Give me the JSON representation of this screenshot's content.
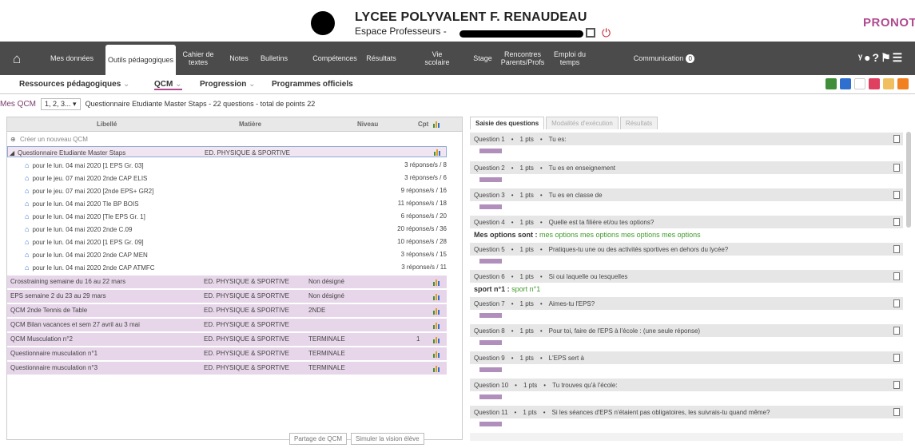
{
  "header": {
    "school": "LYCEE POLYVALENT F. RENAUDEAU",
    "space": "Espace Professeurs -",
    "logo": "PRONOTE",
    "power_icon": "power-icon",
    "qr_icon": "qr-code-icon"
  },
  "nav": {
    "items": [
      {
        "label": "Mes données"
      },
      {
        "label": "Outils pédagogiques"
      },
      {
        "label": "Cahier de textes"
      },
      {
        "label": "Notes"
      },
      {
        "label": "Bulletins"
      },
      {
        "label": "Compétences"
      },
      {
        "label": "Résultats"
      },
      {
        "label": "Vie scolaire"
      },
      {
        "label": "Stage"
      },
      {
        "label": "Rencontres Parents/Profs"
      },
      {
        "label": "Emploi du temps"
      },
      {
        "label": "Communication"
      }
    ],
    "communication_badge": "0",
    "home_icon": "home-icon"
  },
  "subnav": {
    "ressources": "Ressources pédagogiques",
    "qcm": "QCM",
    "progression": "Progression",
    "programmes": "Programmes officiels"
  },
  "mesqcm": {
    "label": "Mes QCM",
    "select": "1, 2, 3...",
    "description": "Questionnaire Etudiante Master Staps - 22 questions - total de points 22"
  },
  "table": {
    "headers": {
      "libelle": "Libellé",
      "matiere": "Matière",
      "niveau": "Niveau",
      "cpt": "Cpt"
    },
    "create": "Créer un nouveau QCM",
    "selected": {
      "label": "Questionnaire Etudiante Master Staps",
      "matiere": "ED. PHYSIQUE & SPORTIVE"
    },
    "sessions": [
      {
        "label": "pour le lun. 04 mai 2020  [1 EPS Gr. 03]",
        "resp": "3 réponse/s / 8"
      },
      {
        "label": "pour le jeu. 07 mai 2020  2nde CAP ELIS",
        "resp": "3 réponse/s / 6"
      },
      {
        "label": "pour le jeu. 07 mai 2020  [2nde EPS+ GR2]",
        "resp": "9 réponse/s / 16"
      },
      {
        "label": "pour le lun. 04 mai 2020  Tle BP BOIS",
        "resp": "11 réponse/s / 18"
      },
      {
        "label": "pour le lun. 04 mai 2020  [Tle EPS Gr. 1]",
        "resp": "6 réponse/s / 20"
      },
      {
        "label": "pour le lun. 04 mai 2020  2nde C.09",
        "resp": "20 réponse/s / 36"
      },
      {
        "label": "pour le lun. 04 mai 2020  [1 EPS Gr. 09]",
        "resp": "10 réponse/s / 28"
      },
      {
        "label": "pour le lun. 04 mai 2020  2nde CAP MEN",
        "resp": "3 réponse/s / 15"
      },
      {
        "label": "pour le lun. 04 mai 2020  2nde CAP ATMFC",
        "resp": "3 réponse/s / 11"
      }
    ],
    "qcms": [
      {
        "label": "Crosstraining semaine du 16 au 22 mars",
        "matiere": "ED. PHYSIQUE & SPORTIVE",
        "niveau": "Non désigné",
        "cpt": ""
      },
      {
        "label": "EPS semaine 2 du 23 au 29 mars",
        "matiere": "ED. PHYSIQUE & SPORTIVE",
        "niveau": "Non désigné",
        "cpt": ""
      },
      {
        "label": "QCM 2nde Tennis de Table",
        "matiere": "ED. PHYSIQUE & SPORTIVE",
        "niveau": "2NDE",
        "cpt": ""
      },
      {
        "label": "QCM Bilan vacances et sem 27 avril au 3 mai",
        "matiere": "ED. PHYSIQUE & SPORTIVE",
        "niveau": "",
        "cpt": ""
      },
      {
        "label": "QCM Musculation n°2",
        "matiere": "ED. PHYSIQUE & SPORTIVE",
        "niveau": "TERMINALE",
        "cpt": "1"
      },
      {
        "label": "Questionnaire musculation n°1",
        "matiere": "ED. PHYSIQUE & SPORTIVE",
        "niveau": "TERMINALE",
        "cpt": ""
      },
      {
        "label": "Questionnaire musculation n°3",
        "matiere": "ED. PHYSIQUE & SPORTIVE",
        "niveau": "TERMINALE",
        "cpt": ""
      }
    ]
  },
  "footer": {
    "partage": "Partage de QCM",
    "simuler": "Simuler la vision élève"
  },
  "right": {
    "tabs": [
      "Saisie des questions",
      "Modalités d'exécution",
      "Résultats"
    ],
    "questions": [
      {
        "num": "Question 1",
        "pts": "1 pts",
        "text": "Tu es:"
      },
      {
        "num": "Question 2",
        "pts": "1 pts",
        "text": "Tu es en enseignement"
      },
      {
        "num": "Question 3",
        "pts": "1 pts",
        "text": "Tu es en classe de"
      },
      {
        "num": "Question 4",
        "pts": "1 pts",
        "text": "Quelle est ta filière et/ou tes options?"
      },
      {
        "num": "Question 5",
        "pts": "1 pts",
        "text": "Pratiques-tu une ou des activités sportives en dehors du lycée?"
      },
      {
        "num": "Question 6",
        "pts": "1 pts",
        "text": "Si oui laquelle ou lesquelles"
      },
      {
        "num": "Question 7",
        "pts": "1 pts",
        "text": "Aimes-tu l'EPS?"
      },
      {
        "num": "Question 8",
        "pts": "1 pts",
        "text": "Pour toi, faire de l'EPS à l'école : (une seule réponse)"
      },
      {
        "num": "Question 9",
        "pts": "1 pts",
        "text": "L'EPS sert à"
      },
      {
        "num": "Question 10",
        "pts": "1 pts",
        "text": "Tu trouves qu'à l'école:"
      },
      {
        "num": "Question 11",
        "pts": "1 pts",
        "text": "Si les séances d'EPS n'étaient pas obligatoires, les suivrais-tu quand même?"
      }
    ],
    "options_label": "Mes options sont :",
    "options_value": "mes options mes options mes options mes options",
    "sport_label": "sport n°1 :",
    "sport_value": "sport n°1"
  }
}
